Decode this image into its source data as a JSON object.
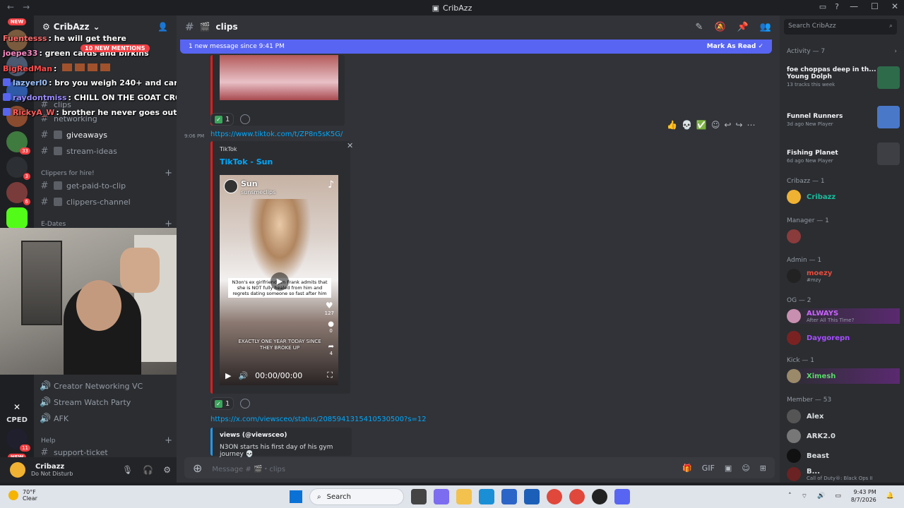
{
  "app": {
    "title": "CribAzz"
  },
  "server": {
    "name": "CribAzz"
  },
  "channel": {
    "name": "clips"
  },
  "sidebar": {
    "channels": [
      {
        "label": "networking"
      },
      {
        "label": "giveaways"
      },
      {
        "label": "stream-ideas"
      },
      {
        "label": "get-paid-to-clip"
      },
      {
        "label": "clippers-channel"
      },
      {
        "label": "clips"
      }
    ],
    "categories": [
      {
        "label": "Clippers for hire!"
      },
      {
        "label": "E-Dates"
      },
      {
        "label": "Help"
      }
    ],
    "voice": [
      {
        "label": "Creator Networking VC"
      },
      {
        "label": "Stream Watch Party"
      },
      {
        "label": "AFK"
      }
    ],
    "support": "support-ticket"
  },
  "rail": {
    "new1": "NEW",
    "new2": "NEW",
    "cped": "CPED",
    "badges": [
      "33",
      "3",
      "6",
      "81",
      "11"
    ]
  },
  "overlay_chat": [
    {
      "user": "Fuentesss",
      "text": ": he will get there",
      "color": "#ff6b6b"
    },
    {
      "user": "joepe33",
      "text": ": green cards and birkins",
      "color": "#ff8cc6"
    },
    {
      "user": "BigRedMan",
      "text": ":",
      "color": "#ff4d4d"
    },
    {
      "user": "lazyerl0",
      "text": ": bro you weigh 240+ and can't even bench 185",
      "color": "#9ec4ff"
    },
    {
      "user": "raydontmiss",
      "text": ": CHILL ON THE GOAT CRODIE",
      "color": "#9b8cff"
    },
    {
      "user": "RickyA_W",
      "text": ": brother he never goes outside with no security",
      "color": "#ff5c5c"
    }
  ],
  "mentions": "10 NEW MENTIONS",
  "user": {
    "name": "Cribazz",
    "status": "Do Not Disturb"
  },
  "new_messages": {
    "text": "1 new message since 9:41 PM",
    "action": "Mark As Read"
  },
  "messages": {
    "reaction_count_1": "1",
    "time": "9:06 PM",
    "tiktok_link": "https://www.tiktok.com/t/ZP8n5sK5G/",
    "embed_provider": "TikTok",
    "embed_title": "TikTok - Sun",
    "video": {
      "channel": "Sun",
      "handle": "sunsmeclips",
      "caption": "N3on's ex girlfriend Jim Frank admits that she is NOT fully healed from him and regrets dating someone so fast after him",
      "caption2": "EXACTLY ONE YEAR TODAY SINCE THEY BROKE UP",
      "likes": "127",
      "comments": "0",
      "shares": "4",
      "time": "00:00/00:00"
    },
    "reaction_count_2": "1",
    "x_link": "https://x.com/viewsceo/status/2085941315410530500?s=12",
    "x_author": "views (@viewsceo)",
    "x_text": "N3ON starts his first day of his gym journey 💀"
  },
  "composer": {
    "placeholder": "Message # 🎬・clips"
  },
  "members": {
    "search_placeholder": "Search CribAzz",
    "activity_header": "Activity — 7",
    "activities": [
      {
        "title": "foe choppas deep in th...",
        "sub_title": "Young Dolph",
        "detail": "13 tracks this week"
      },
      {
        "title": "Funnel Runners",
        "detail": "3d ago  New Player"
      },
      {
        "title": "Fishing Planet",
        "detail": "6d ago  New Player"
      }
    ],
    "groups": [
      {
        "label": "Cribazz — 1"
      },
      {
        "label": "Manager — 1"
      },
      {
        "label": "Admin — 1"
      },
      {
        "label": "OG — 2"
      },
      {
        "label": "Kick — 1"
      },
      {
        "label": "Member — 53"
      }
    ],
    "people": [
      {
        "name": "Cribazz",
        "color": "#1abc9c",
        "sub": ""
      },
      {
        "name": "moezy",
        "color": "#e74c3c",
        "sub": "#mzy"
      },
      {
        "name": "ALWAYS",
        "color": "#c964ff",
        "sub": "After All This Time?"
      },
      {
        "name": "Daygorepn",
        "color": "#a64dff",
        "sub": ""
      },
      {
        "name": "Ximesh",
        "color": "#5bd96b",
        "sub": ""
      },
      {
        "name": "Alex",
        "color": "#f2f3f5",
        "sub": ""
      },
      {
        "name": "ARK2.0",
        "color": "#f2f3f5",
        "sub": ""
      },
      {
        "name": "Beast",
        "color": "#f2f3f5",
        "sub": ""
      },
      {
        "name": "B...",
        "color": "#f2f3f5",
        "sub": "Call of Duty®: Black Ops II"
      }
    ]
  },
  "taskbar": {
    "temp": "70°F",
    "condition": "Clear",
    "search": "Search",
    "time": "9:43 PM",
    "date": "8/7/2026"
  }
}
